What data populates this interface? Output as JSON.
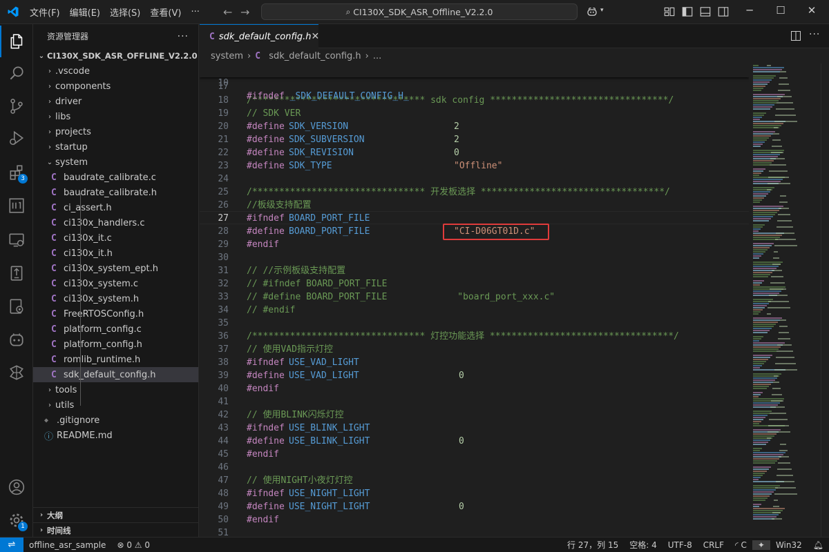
{
  "window": {
    "menu": [
      "文件(F)",
      "编辑(E)",
      "选择(S)",
      "查看(V)",
      "···"
    ],
    "search": "CI130X_SDK_ASR_Offline_V2.2.0"
  },
  "activity": {
    "extensions_badge": "3",
    "settings_badge": "1"
  },
  "explorer": {
    "title": "资源管理器",
    "more": "···",
    "project": "CI130X_SDK_ASR_OFFLINE_V2.2.0",
    "folders_top": [
      ".vscode",
      "components",
      "driver",
      "libs",
      "projects",
      "startup"
    ],
    "open_folder": "system",
    "files": [
      "baudrate_calibrate.c",
      "baudrate_calibrate.h",
      "ci_assert.h",
      "ci130x_handlers.c",
      "ci130x_it.c",
      "ci130x_it.h",
      "ci130x_system_ept.h",
      "ci130x_system.c",
      "ci130x_system.h",
      "FreeRTOSConfig.h",
      "platform_config.c",
      "platform_config.h",
      "romlib_runtime.h",
      "sdk_default_config.h"
    ],
    "file_icon": "C",
    "folders_bottom": [
      "tools",
      "utils"
    ],
    "gitignore": ".gitignore",
    "readme": "README.md",
    "outline": "大纲",
    "timeline": "时间线"
  },
  "editor": {
    "tab": "sdk_default_config.h",
    "breadcrumb": [
      "system",
      "sdk_default_config.h",
      "..."
    ],
    "sticky": {
      "n": "10",
      "kw": "#ifndef",
      "name": "_SDK_DEFAULT_CONFIG_H_"
    },
    "lines": [
      {
        "n": "17"
      },
      {
        "n": "18",
        "cmt": "/******************************** sdk config *********************************/"
      },
      {
        "n": "19",
        "cmt": "// SDK VER"
      },
      {
        "n": "20",
        "kw": "#define",
        "name": "SDK_VERSION",
        "num": "2"
      },
      {
        "n": "21",
        "kw": "#define",
        "name": "SDK_SUBVERSION",
        "num": "2"
      },
      {
        "n": "22",
        "kw": "#define",
        "name": "SDK_REVISION",
        "num": "0"
      },
      {
        "n": "23",
        "kw": "#define",
        "name": "SDK_TYPE",
        "str": "\"Offline\""
      },
      {
        "n": "24"
      },
      {
        "n": "25",
        "cmt": "/******************************** 开发板选择 **********************************/"
      },
      {
        "n": "26",
        "cmt": "//板级支持配置"
      },
      {
        "n": "27",
        "kw": "#ifndef",
        "name": "BOARD_PORT_FILE"
      },
      {
        "n": "28",
        "kw": "#define",
        "name": "BOARD_PORT_FILE",
        "str": "\"CI-D06GT01D.c\""
      },
      {
        "n": "29",
        "kw": "#endif"
      },
      {
        "n": "30"
      },
      {
        "n": "31",
        "cmt": "// //示例板级支持配置"
      },
      {
        "n": "32",
        "cmt": "// #ifndef BOARD_PORT_FILE"
      },
      {
        "n": "33",
        "cmt": "// #define BOARD_PORT_FILE             \"board_port_xxx.c\""
      },
      {
        "n": "34",
        "cmt": "// #endif"
      },
      {
        "n": "35"
      },
      {
        "n": "36",
        "cmt": "/******************************** 灯控功能选择 **********************************/"
      },
      {
        "n": "37",
        "cmt": "// 使用VAD指示灯控"
      },
      {
        "n": "38",
        "kw": "#ifndef",
        "name": "USE_VAD_LIGHT"
      },
      {
        "n": "39",
        "kw": "#define",
        "name": "USE_VAD_LIGHT",
        "num": "0"
      },
      {
        "n": "40",
        "kw": "#endif"
      },
      {
        "n": "41"
      },
      {
        "n": "42",
        "cmt": "// 使用BLINK闪烁灯控"
      },
      {
        "n": "43",
        "kw": "#ifndef",
        "name": "USE_BLINK_LIGHT"
      },
      {
        "n": "44",
        "kw": "#define",
        "name": "USE_BLINK_LIGHT",
        "num": "0"
      },
      {
        "n": "45",
        "kw": "#endif"
      },
      {
        "n": "46"
      },
      {
        "n": "47",
        "cmt": "// 使用NIGHT小夜灯灯控"
      },
      {
        "n": "48",
        "kw": "#ifndef",
        "name": "USE_NIGHT_LIGHT"
      },
      {
        "n": "49",
        "kw": "#define",
        "name": "USE_NIGHT_LIGHT",
        "num": "0"
      },
      {
        "n": "50",
        "kw": "#endif"
      },
      {
        "n": "51"
      }
    ],
    "current_line": "27"
  },
  "status": {
    "branch": "offline_asr_sample",
    "errors": "0",
    "warnings": "0",
    "position": "行 27，列 15",
    "indent": "空格: 4",
    "encoding": "UTF-8",
    "eol": "CRLF",
    "language": "C",
    "platform": "Win32"
  }
}
